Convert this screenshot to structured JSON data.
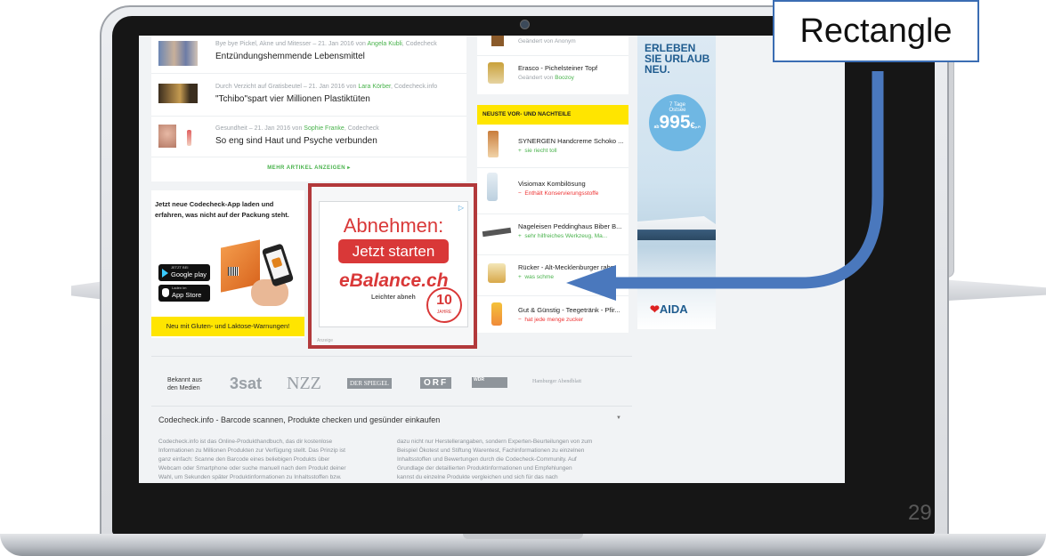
{
  "articles": [
    {
      "category": "Bye bye Pickel, Akne und Mitesser",
      "date": "21. Jan 2016",
      "by": "von",
      "author": "Angela Kubli",
      "source": "Codecheck",
      "title": "Entzündungshemmende Lebensmittel"
    },
    {
      "category": "Durch Verzicht auf Gratisbeutel",
      "date": "21. Jan 2016",
      "by": "von",
      "author": "Lara Körber",
      "source": "Codecheck.info",
      "title": "\"Tchibo\"spart vier Millionen Plastiktüten"
    },
    {
      "category": "Gesundheit",
      "date": "21. Jan 2016",
      "by": "von",
      "author": "Sophie Franke",
      "source": "Codecheck",
      "title": "So eng sind Haut und Psyche verbunden"
    }
  ],
  "more_articles_label": "MEHR ARTIKEL ANZEIGEN ▸",
  "app_promo": {
    "headline_1": "Jetzt neue Codecheck-App laden und",
    "headline_2": "erfahren, was nicht auf der Packung steht.",
    "google_play_small": "JETZT BEI",
    "google_play": "Google play",
    "app_store_small": "Laden im",
    "app_store": "App Store",
    "banner": "Neu mit Gluten- und Laktose-Warnungen!"
  },
  "ad": {
    "title": "Abnehmen:",
    "button": "Jetzt starten",
    "brand": "eBalance.ch",
    "tagline": "Leichter abneh",
    "badge_number": "10",
    "badge_text": "JAHRE",
    "label": "Anzeige",
    "ad_icon": "adchoices-icon"
  },
  "recent_changes": [
    {
      "name": "",
      "sub": "Geändert von Anonym"
    },
    {
      "name": "Erasco - Pichelsteiner Topf",
      "sub_prefix": "Geändert von",
      "sub_user": "Boozoy"
    }
  ],
  "pros_cons": {
    "header": "NEUSTE VOR- UND NACHTEILE",
    "items": [
      {
        "name": "SYNERGEN Handcreme Schoko ...",
        "sign": "+",
        "note": "sie riecht toll",
        "kind": "plus"
      },
      {
        "name": "Visiomax Kombilösung",
        "sign": "−",
        "note": "Enthält Konservierungsstoffe",
        "kind": "minus"
      },
      {
        "name": "Nageleisen Peddinghaus Biber B...",
        "sign": "+",
        "note": "sehr hilfreiches Werkzeug, Ma...",
        "kind": "plus"
      },
      {
        "name": "Rücker - Alt-Mecklenburger rahm",
        "sign": "+",
        "note": "was schme",
        "kind": "plus"
      },
      {
        "name": "Gut & Günstig - Teegetränk - Pfir...",
        "sign": "−",
        "note": "hat jede menge zucker",
        "kind": "minus"
      }
    ]
  },
  "skyscraper_ad": {
    "line1": "ERLEBEN",
    "line2": "SIE URLAUB",
    "line3": "NEU.",
    "badge_top": "7 Tage",
    "badge_mid": "Ostsee",
    "badge_prefix": "ab",
    "price": "995",
    "currency": "€",
    "price_suffix": "p.P.",
    "brand": "AIDA"
  },
  "media": {
    "label_1": "Bekannt aus",
    "label_2": "den Medien",
    "logos": [
      "3sat",
      "NZZ",
      "DER SPIEGEL",
      "ORF",
      "WDR",
      "Hamburger Abendblatt"
    ]
  },
  "footer": {
    "title": "Codecheck.info - Barcode scannen, Produkte checken und gesünder einkaufen",
    "col1": [
      "Codecheck.info ist das Online-Produkthandbuch, das dir kostenlose",
      "Informationen zu Millionen Produkten zur Verfügung stellt. Das Prinzip ist",
      "ganz einfach: Scanne den Barcode eines beliebigen Produkts über",
      "Webcam oder Smartphone oder suche manuell nach dem Produkt deiner",
      "Wahl, um Sekunden später Produktinformationen zu Inhaltsstoffen bzw."
    ],
    "col2": [
      "dazu nicht nur Herstellerangaben, sondern Experten-Beurteilungen von zum",
      "Beispiel Ökotest und Stiftung Warentest, Fachinformationen zu einzelnen",
      "Inhaltsstoffen und Bewertungen durch die Codecheck-Community. Auf",
      "Grundlage der detaillierten Produktinformationen und Empfehlungen",
      "kannst du einzelne Produkte vergleichen und sich für das nach"
    ]
  },
  "callout": "Rectangle",
  "page_number": "29",
  "colors": {
    "accent_green": "#48b24b",
    "highlight_red": "#b2393b",
    "arrow_blue": "#4a78bd",
    "yellow": "#ffe500"
  }
}
